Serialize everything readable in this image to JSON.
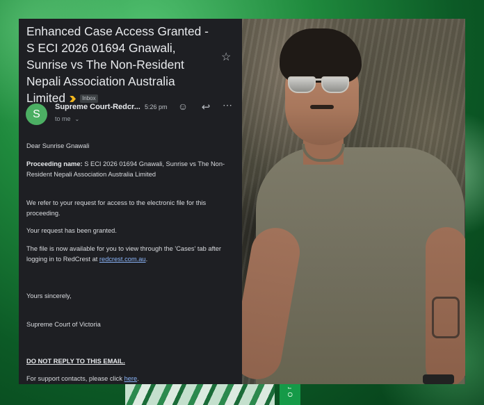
{
  "email": {
    "subject": "Enhanced Case Access Granted - S ECI 2026 01694 Gnawali, Sunrise vs The Non-Resident Nepali Association Australia Limited",
    "label_chip": "Inbox",
    "star_glyph": "☆",
    "sender": {
      "avatar_letter": "S",
      "name": "Supreme Court-Redcr...",
      "time": "5:26 pm",
      "recipient": "to me"
    },
    "actions": {
      "react_glyph": "☺",
      "reply_glyph": "↩",
      "more_glyph": "⋯"
    },
    "body": {
      "greeting": "Dear Sunrise Gnawali",
      "proceeding_label": "Proceeding name:",
      "proceeding_value": "S ECI 2026 01694 Gnawali, Sunrise vs The Non-Resident Nepali Association Australia Limited",
      "refer": "We refer to your request for access to the electronic file for this proceeding.",
      "granted": "Your request has been granted.",
      "file_text": "The file is now available for you to view through the 'Cases' tab after logging in to RedCrest at",
      "file_link": "redcrest.com.au",
      "file_end": ".",
      "signoff": "Yours sincerely,",
      "signature": "Supreme Court of Victoria",
      "do_not_reply": "DO NOT REPLY TO THIS EMAIL.",
      "support_text": "For support contacts, please click",
      "support_link": "here",
      "support_end": "."
    }
  },
  "colors": {
    "background_green": "#1f8a3d",
    "email_panel": "#1e1f23",
    "avatar": "#4caf63",
    "link": "#8ab4f8",
    "importance_marker": "#f2b61e"
  },
  "decor": {
    "side_tab_text": "ɹ O"
  }
}
